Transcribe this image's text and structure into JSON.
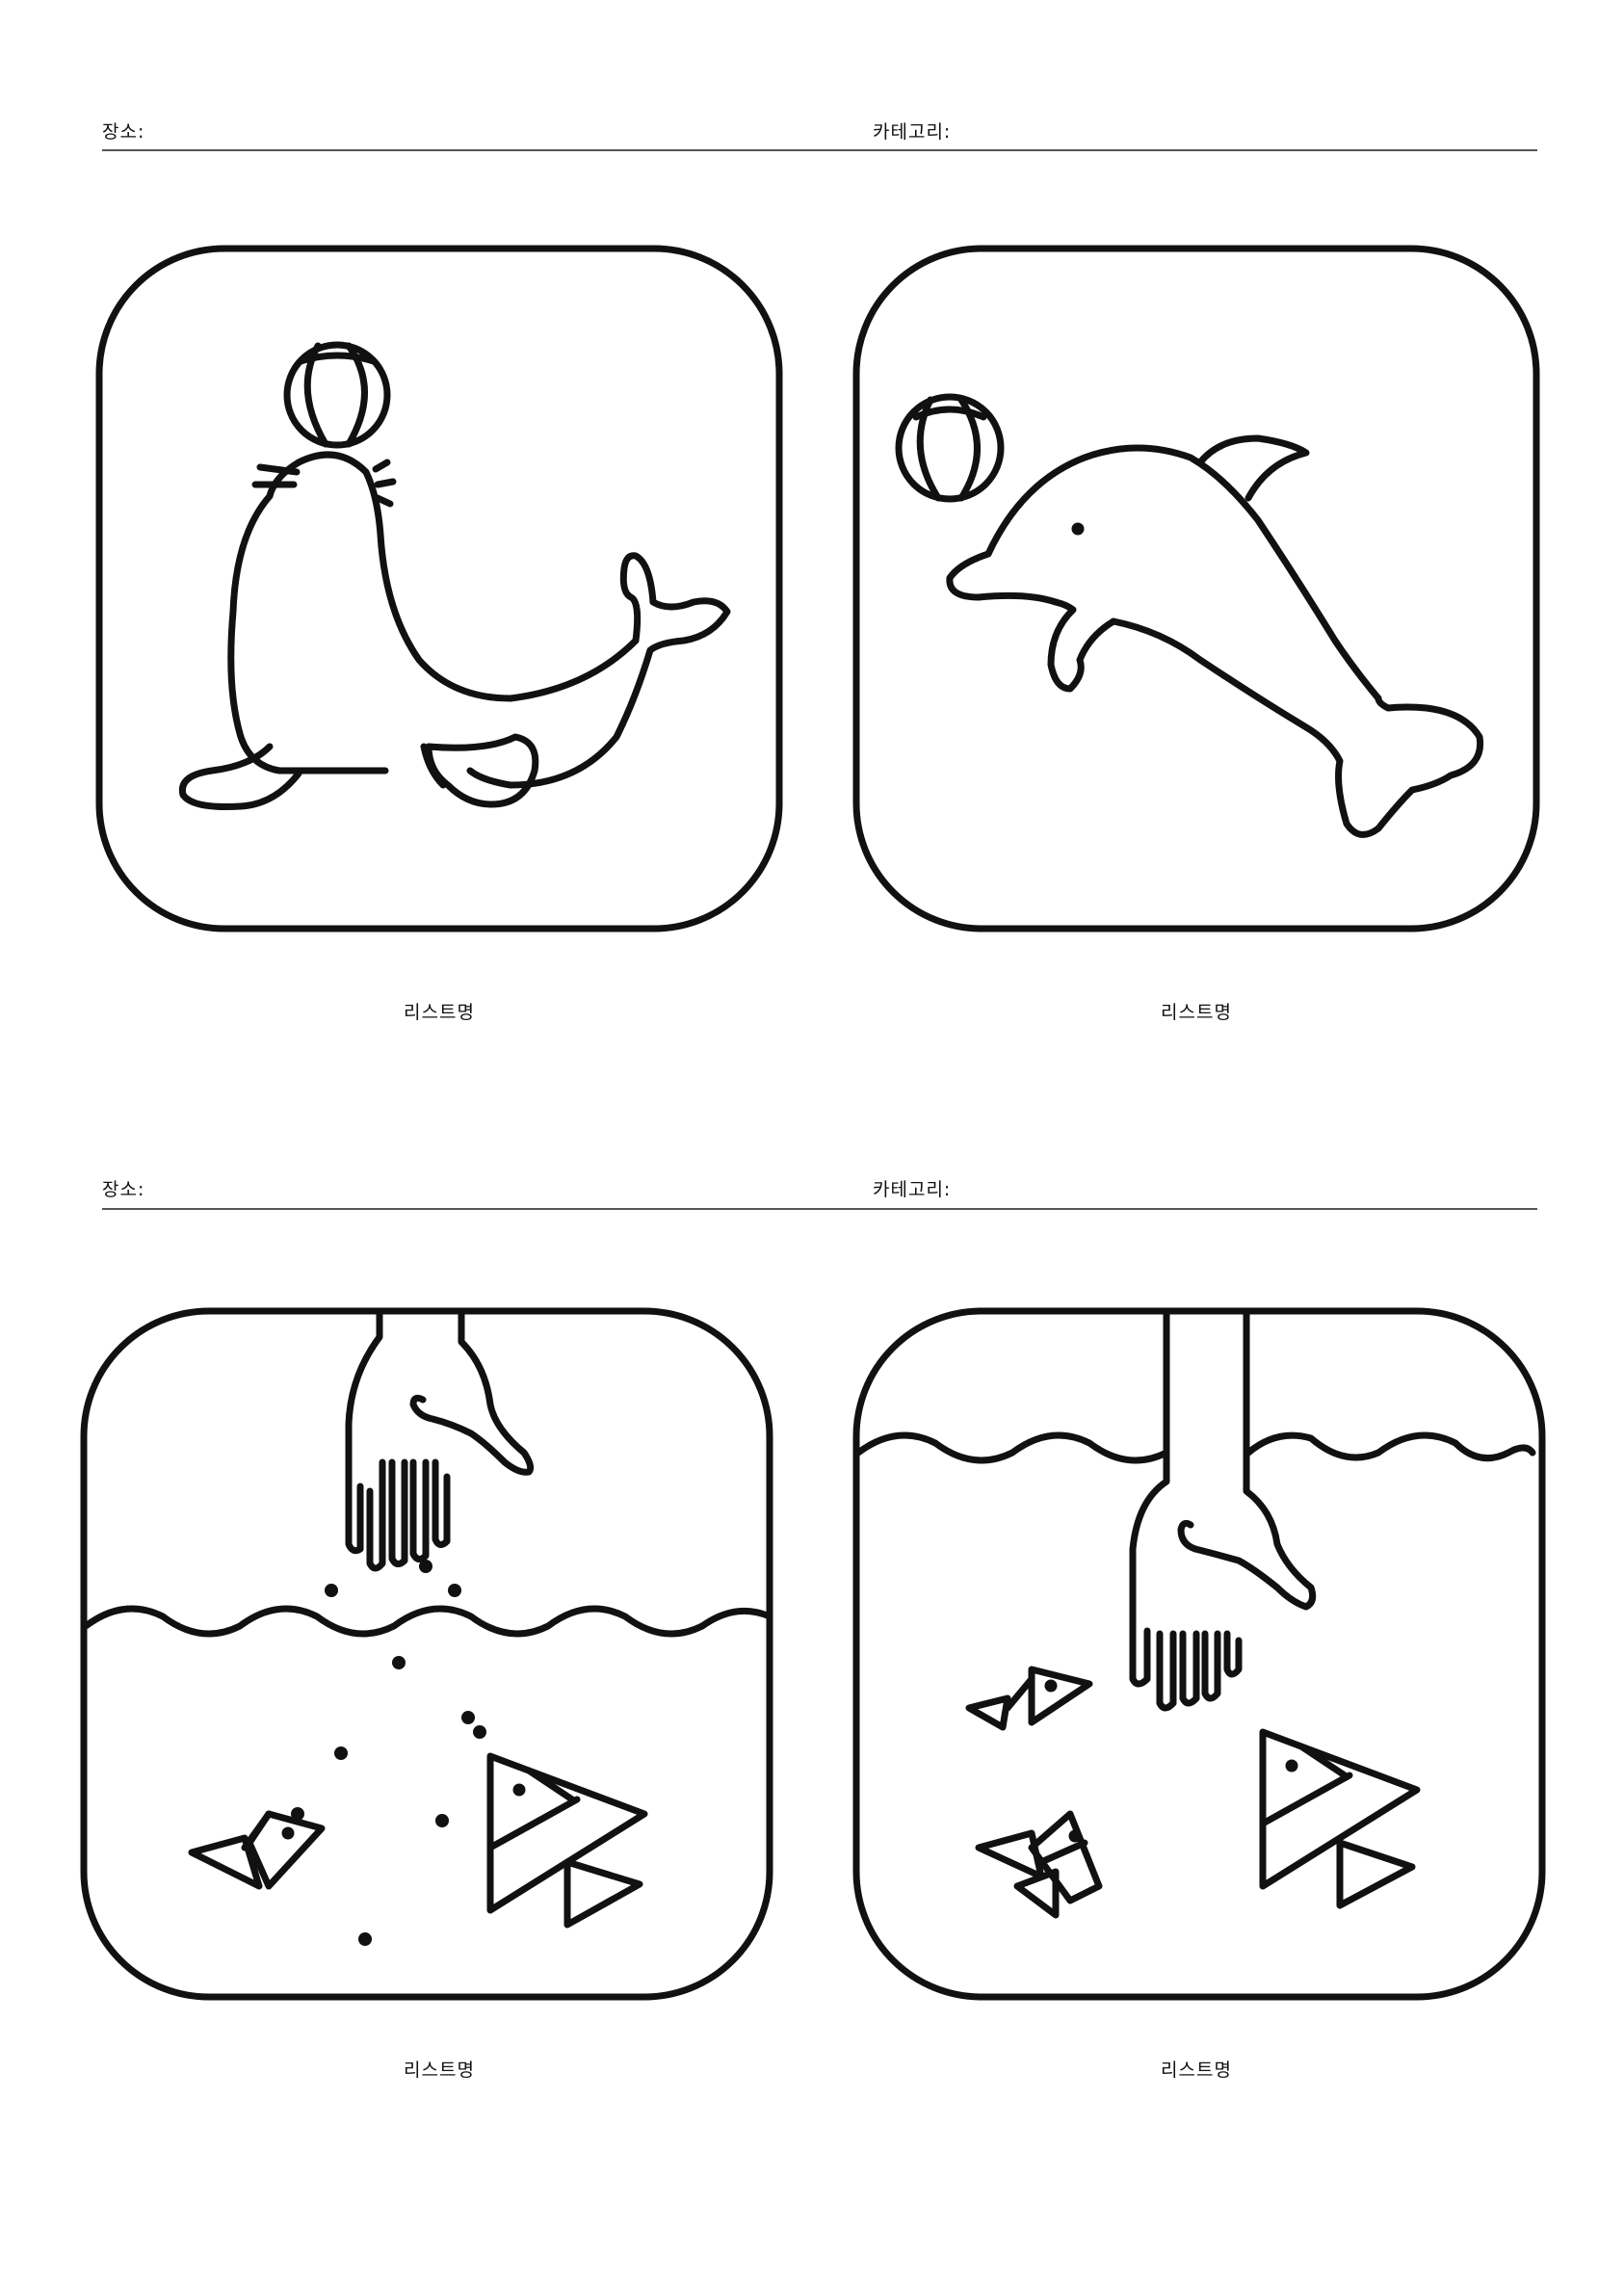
{
  "sections": [
    {
      "location_label": "장소:",
      "category_label": "카테고리:",
      "cards": [
        {
          "caption": "리스트명",
          "illustration": "seal-ball-icon"
        },
        {
          "caption": "리스트명",
          "illustration": "dolphin-ball-icon"
        }
      ]
    },
    {
      "location_label": "장소:",
      "category_label": "카테고리:",
      "cards": [
        {
          "caption": "리스트명",
          "illustration": "feeding-fish-icon"
        },
        {
          "caption": "리스트명",
          "illustration": "hand-fish-underwater-icon"
        }
      ]
    }
  ]
}
